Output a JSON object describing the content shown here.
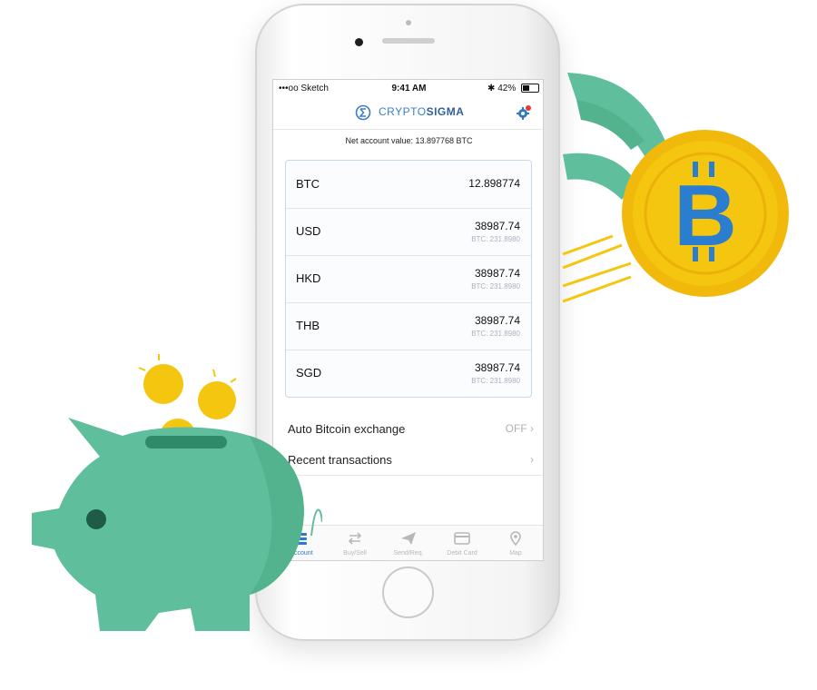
{
  "status_bar": {
    "carrier": "•••oo Sketch",
    "time": "9:41 AM",
    "battery": "42%"
  },
  "app": {
    "logo_prefix": "CRYPTO",
    "logo_suffix": "SIGMA"
  },
  "account": {
    "net_value_label": "Net account value: 13.897768 BTC"
  },
  "balances": [
    {
      "currency": "BTC",
      "amount": "12.898774",
      "btc_equiv": ""
    },
    {
      "currency": "USD",
      "amount": "38987.74",
      "btc_equiv": "BTC: 231.8980"
    },
    {
      "currency": "HKD",
      "amount": "38987.74",
      "btc_equiv": "BTC: 231.8980"
    },
    {
      "currency": "THB",
      "amount": "38987.74",
      "btc_equiv": "BTC: 231.8980"
    },
    {
      "currency": "SGD",
      "amount": "38987.74",
      "btc_equiv": "BTC: 231.8980"
    }
  ],
  "settings_rows": {
    "auto_exchange": {
      "label": "Auto Bitcoin exchange",
      "value": "OFF"
    },
    "recent_transactions": {
      "label": "Recent transactions"
    }
  },
  "tabs": [
    {
      "label": "Account",
      "icon": "stack-icon",
      "active": true
    },
    {
      "label": "Buy/Sell",
      "icon": "swap-icon",
      "active": false
    },
    {
      "label": "Send/Req.",
      "icon": "paper-plane-icon",
      "active": false
    },
    {
      "label": "Debit Card",
      "icon": "card-icon",
      "active": false
    },
    {
      "label": "Map",
      "icon": "map-pin-icon",
      "active": false
    }
  ],
  "illustration": {
    "coin_symbol": "B"
  },
  "colors": {
    "accent_blue": "#2f79c9",
    "pig_green": "#5fbf9d",
    "coin_yellow": "#f5c60f",
    "coin_blue": "#2b7ecf"
  }
}
